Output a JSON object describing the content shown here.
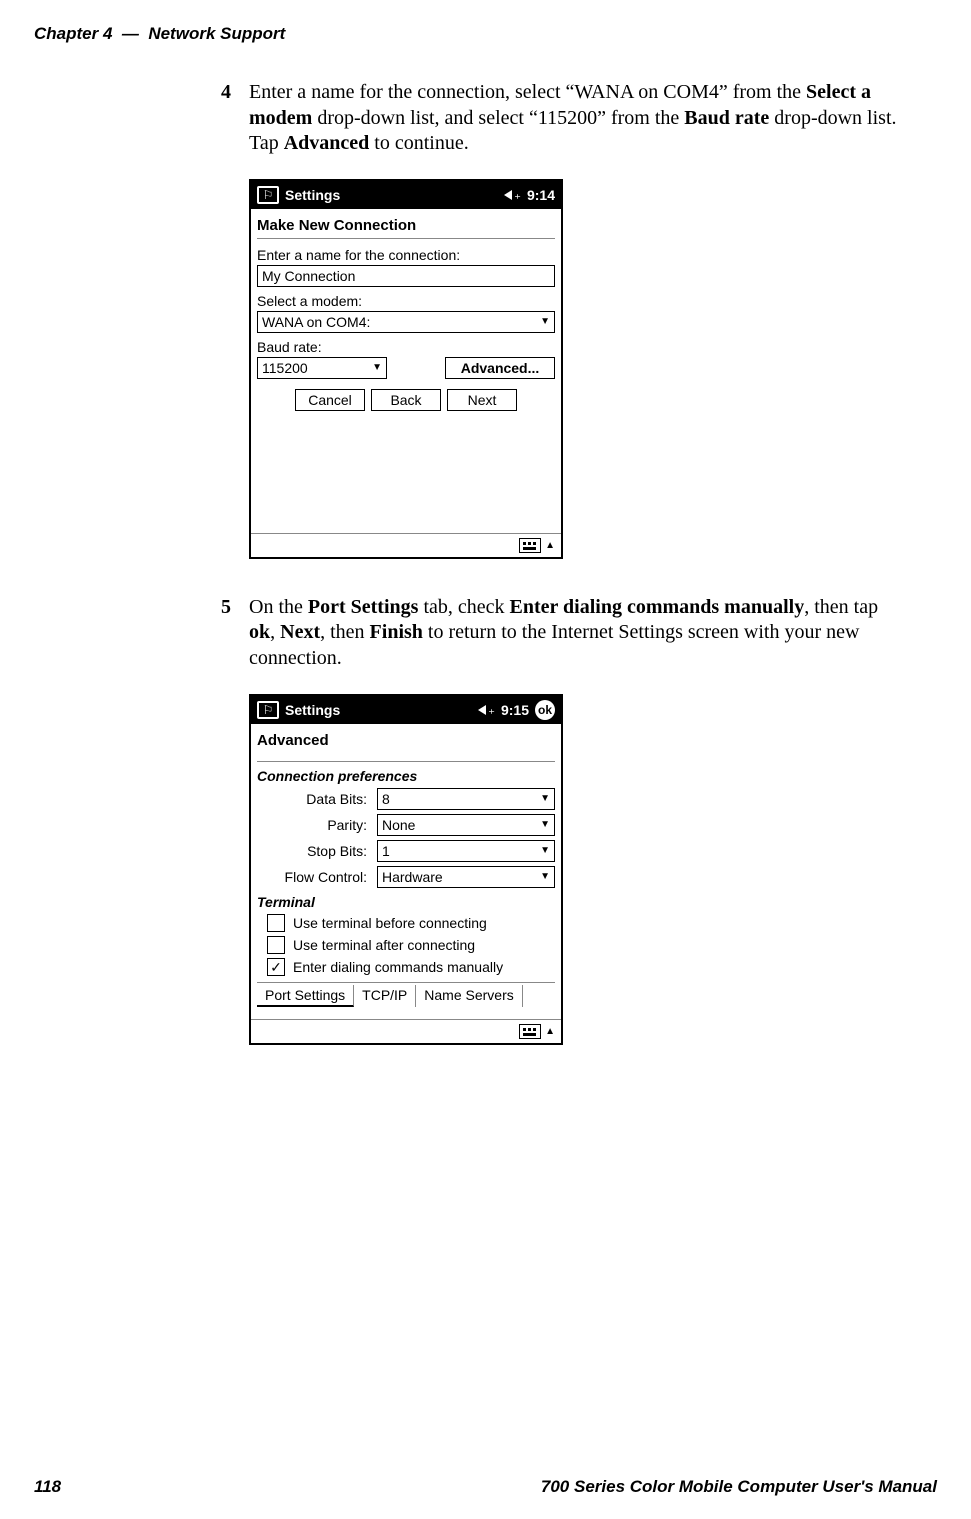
{
  "page_header": {
    "chapter": "Chapter 4",
    "dash": "—",
    "section": "Network Support"
  },
  "page_footer": {
    "page_num": "118",
    "manual_title": "700 Series Color Mobile Computer User's Manual"
  },
  "step4": {
    "num": "4",
    "t1": "Enter a name for the connection, select “WANA on COM4” from the ",
    "b1": "Select a modem",
    "t2": " drop-down list, and select “115200” from the ",
    "b2": "Baud rate",
    "t3": " drop-down list. Tap ",
    "b3": "Advanced",
    "t4": " to continue."
  },
  "step5": {
    "num": "5",
    "t1": "On the ",
    "b1": "Port Settings",
    "t2": " tab, check ",
    "b2": "Enter dialing commands manually",
    "t3": ", then tap ",
    "b3": "ok",
    "t4": ", ",
    "b4": "Next",
    "t5": ", then ",
    "b5": "Finish",
    "t6": " to return to the Internet Settings screen with your new connection."
  },
  "dev_common": {
    "title": "Settings",
    "ok_label": "ok",
    "up_tri": "▲",
    "down_tri": "▼"
  },
  "screen_conn": {
    "time": "9:14",
    "heading": "Make New Connection",
    "lbl_name": "Enter a name for the connection:",
    "val_name": "My Connection",
    "lbl_modem": "Select a modem:",
    "val_modem": "WANA on COM4:",
    "lbl_baud": "Baud rate:",
    "val_baud": "115200",
    "btn_adv": "Advanced...",
    "btn_cancel": "Cancel",
    "btn_back": "Back",
    "btn_next": "Next"
  },
  "screen_adv": {
    "time": "9:15",
    "heading": "Advanced",
    "section1": "Connection preferences",
    "fields": {
      "data_bits_label": "Data Bits:",
      "data_bits_value": "8",
      "parity_label": "Parity:",
      "parity_value": "None",
      "stop_bits_label": "Stop Bits:",
      "stop_bits_value": "1",
      "flow_label": "Flow Control:",
      "flow_value": "Hardware"
    },
    "section2": "Terminal",
    "chk1": "Use terminal before connecting",
    "chk2": "Use terminal after connecting",
    "chk3": "Enter dialing commands manually",
    "tabs": {
      "port": "Port Settings",
      "tcpip": "TCP/IP",
      "ns": "Name Servers"
    }
  }
}
